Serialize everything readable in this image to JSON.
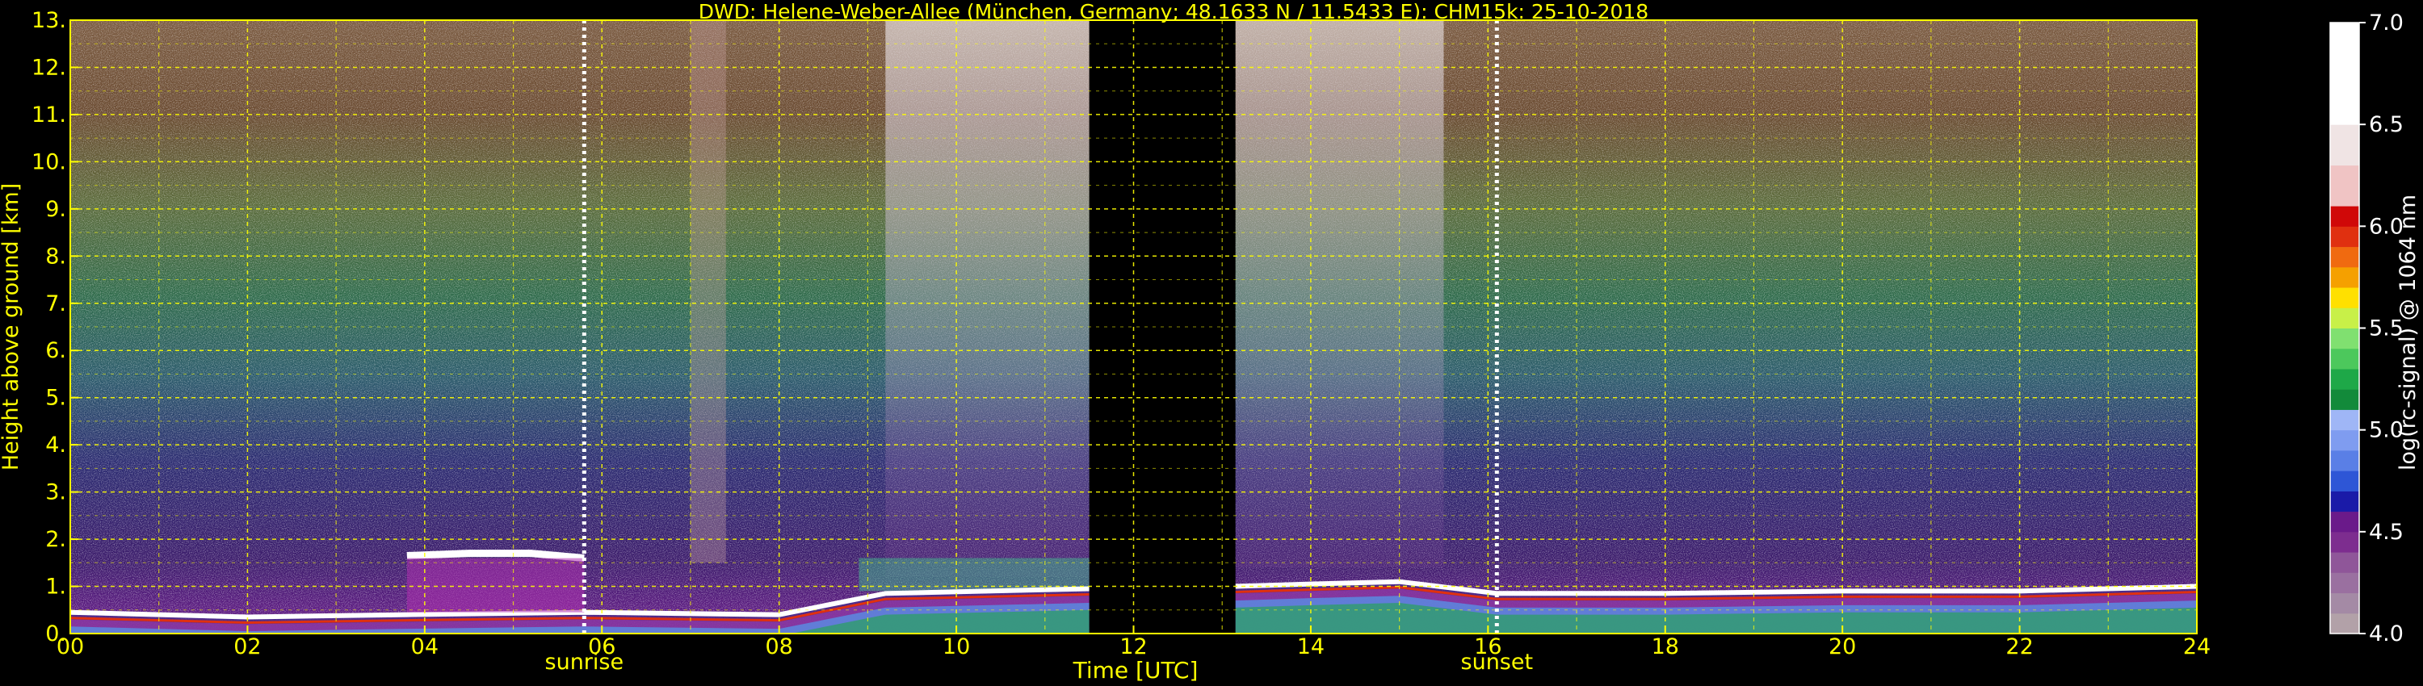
{
  "chart_data": {
    "type": "heatmap",
    "title": "DWD: Helene-Weber-Allee (München, Germany; 48.1633 N / 11.5433 E):    CHM15k: 25-10-2018",
    "xlabel": "Time [UTC]",
    "ylabel": "Height above ground [km]",
    "xlim": [
      0,
      24
    ],
    "ylim": [
      0,
      13
    ],
    "x_ticks": [
      0,
      2,
      4,
      6,
      8,
      10,
      12,
      14,
      16,
      18,
      20,
      22,
      24
    ],
    "x_tick_labels": [
      "00",
      "02",
      "04",
      "06",
      "08",
      "10",
      "12",
      "14",
      "16",
      "18",
      "20",
      "22",
      "24"
    ],
    "y_ticks": [
      0,
      1,
      2,
      3,
      4,
      5,
      6,
      7,
      8,
      9,
      10,
      11,
      12,
      13
    ],
    "y_tick_labels": [
      "0.",
      "1.",
      "2.",
      "3.",
      "4.",
      "5.",
      "6.",
      "7.",
      "8.",
      "9.",
      "10.",
      "11.",
      "12.",
      "13."
    ],
    "grid": true,
    "annotations": [
      {
        "label": "sunrise",
        "x": 5.8
      },
      {
        "label": "sunset",
        "x": 16.1
      }
    ],
    "data_gap": {
      "x_start": 11.5,
      "x_end": 13.15
    },
    "colorbar": {
      "label": "log(rc-signal) @ 1064 nm",
      "range": [
        4.0,
        7.0
      ],
      "ticks": [
        4.0,
        4.5,
        5.0,
        5.5,
        6.0,
        6.5,
        7.0
      ],
      "tick_labels": [
        "4.0",
        "4.5",
        "5.0",
        "5.5",
        "6.0",
        "6.5",
        "7.0"
      ],
      "colors": [
        {
          "from": 4.0,
          "to": 4.1,
          "color": "#b2a1a8"
        },
        {
          "from": 4.1,
          "to": 4.2,
          "color": "#a48aa5"
        },
        {
          "from": 4.2,
          "to": 4.3,
          "color": "#9a70a0"
        },
        {
          "from": 4.3,
          "to": 4.4,
          "color": "#8f5699"
        },
        {
          "from": 4.4,
          "to": 4.5,
          "color": "#7d2d8f"
        },
        {
          "from": 4.5,
          "to": 4.6,
          "color": "#6a1a8a"
        },
        {
          "from": 4.6,
          "to": 4.7,
          "color": "#1a1aa8"
        },
        {
          "from": 4.7,
          "to": 4.8,
          "color": "#2e56d6"
        },
        {
          "from": 4.8,
          "to": 4.9,
          "color": "#5a7fe6"
        },
        {
          "from": 4.9,
          "to": 5.0,
          "color": "#7f9cf0"
        },
        {
          "from": 5.0,
          "to": 5.1,
          "color": "#9fb6f6"
        },
        {
          "from": 5.1,
          "to": 5.2,
          "color": "#128a3a"
        },
        {
          "from": 5.2,
          "to": 5.3,
          "color": "#1ea848"
        },
        {
          "from": 5.3,
          "to": 5.4,
          "color": "#4cc85c"
        },
        {
          "from": 5.4,
          "to": 5.5,
          "color": "#80e070"
        },
        {
          "from": 5.5,
          "to": 5.6,
          "color": "#c8f048"
        },
        {
          "from": 5.6,
          "to": 5.7,
          "color": "#ffe000"
        },
        {
          "from": 5.7,
          "to": 5.8,
          "color": "#f5a000"
        },
        {
          "from": 5.8,
          "to": 5.9,
          "color": "#f06a10"
        },
        {
          "from": 5.9,
          "to": 6.0,
          "color": "#e03010"
        },
        {
          "from": 6.0,
          "to": 6.1,
          "color": "#d00808"
        },
        {
          "from": 6.1,
          "to": 6.3,
          "color": "#f0c4c4"
        },
        {
          "from": 6.3,
          "to": 6.5,
          "color": "#f0e4e4"
        },
        {
          "from": 6.5,
          "to": 7.0,
          "color": "#ffffff"
        }
      ]
    },
    "features": [
      {
        "name": "boundary layer top (night, morning)",
        "x": [
          0,
          2,
          3.8,
          5.8,
          8,
          9.2,
          11.5
        ],
        "y": [
          0.45,
          0.35,
          0.4,
          0.45,
          0.4,
          0.85,
          0.95
        ]
      },
      {
        "name": "residual layer cloud top",
        "x": [
          3.8,
          4.5,
          5.2,
          5.8
        ],
        "y": [
          1.65,
          1.7,
          1.7,
          1.6
        ]
      },
      {
        "name": "boundary layer top (afternoon, evening)",
        "x": [
          13.15,
          14,
          15,
          16.1,
          18,
          20,
          22,
          24
        ],
        "y": [
          1.0,
          1.05,
          1.1,
          0.85,
          0.85,
          0.9,
          0.9,
          1.0
        ]
      }
    ]
  },
  "colors": {
    "axis_text": "#ffff00",
    "colorbar_text": "#ffffff",
    "grid": "#ffff00",
    "background": "#000000"
  }
}
